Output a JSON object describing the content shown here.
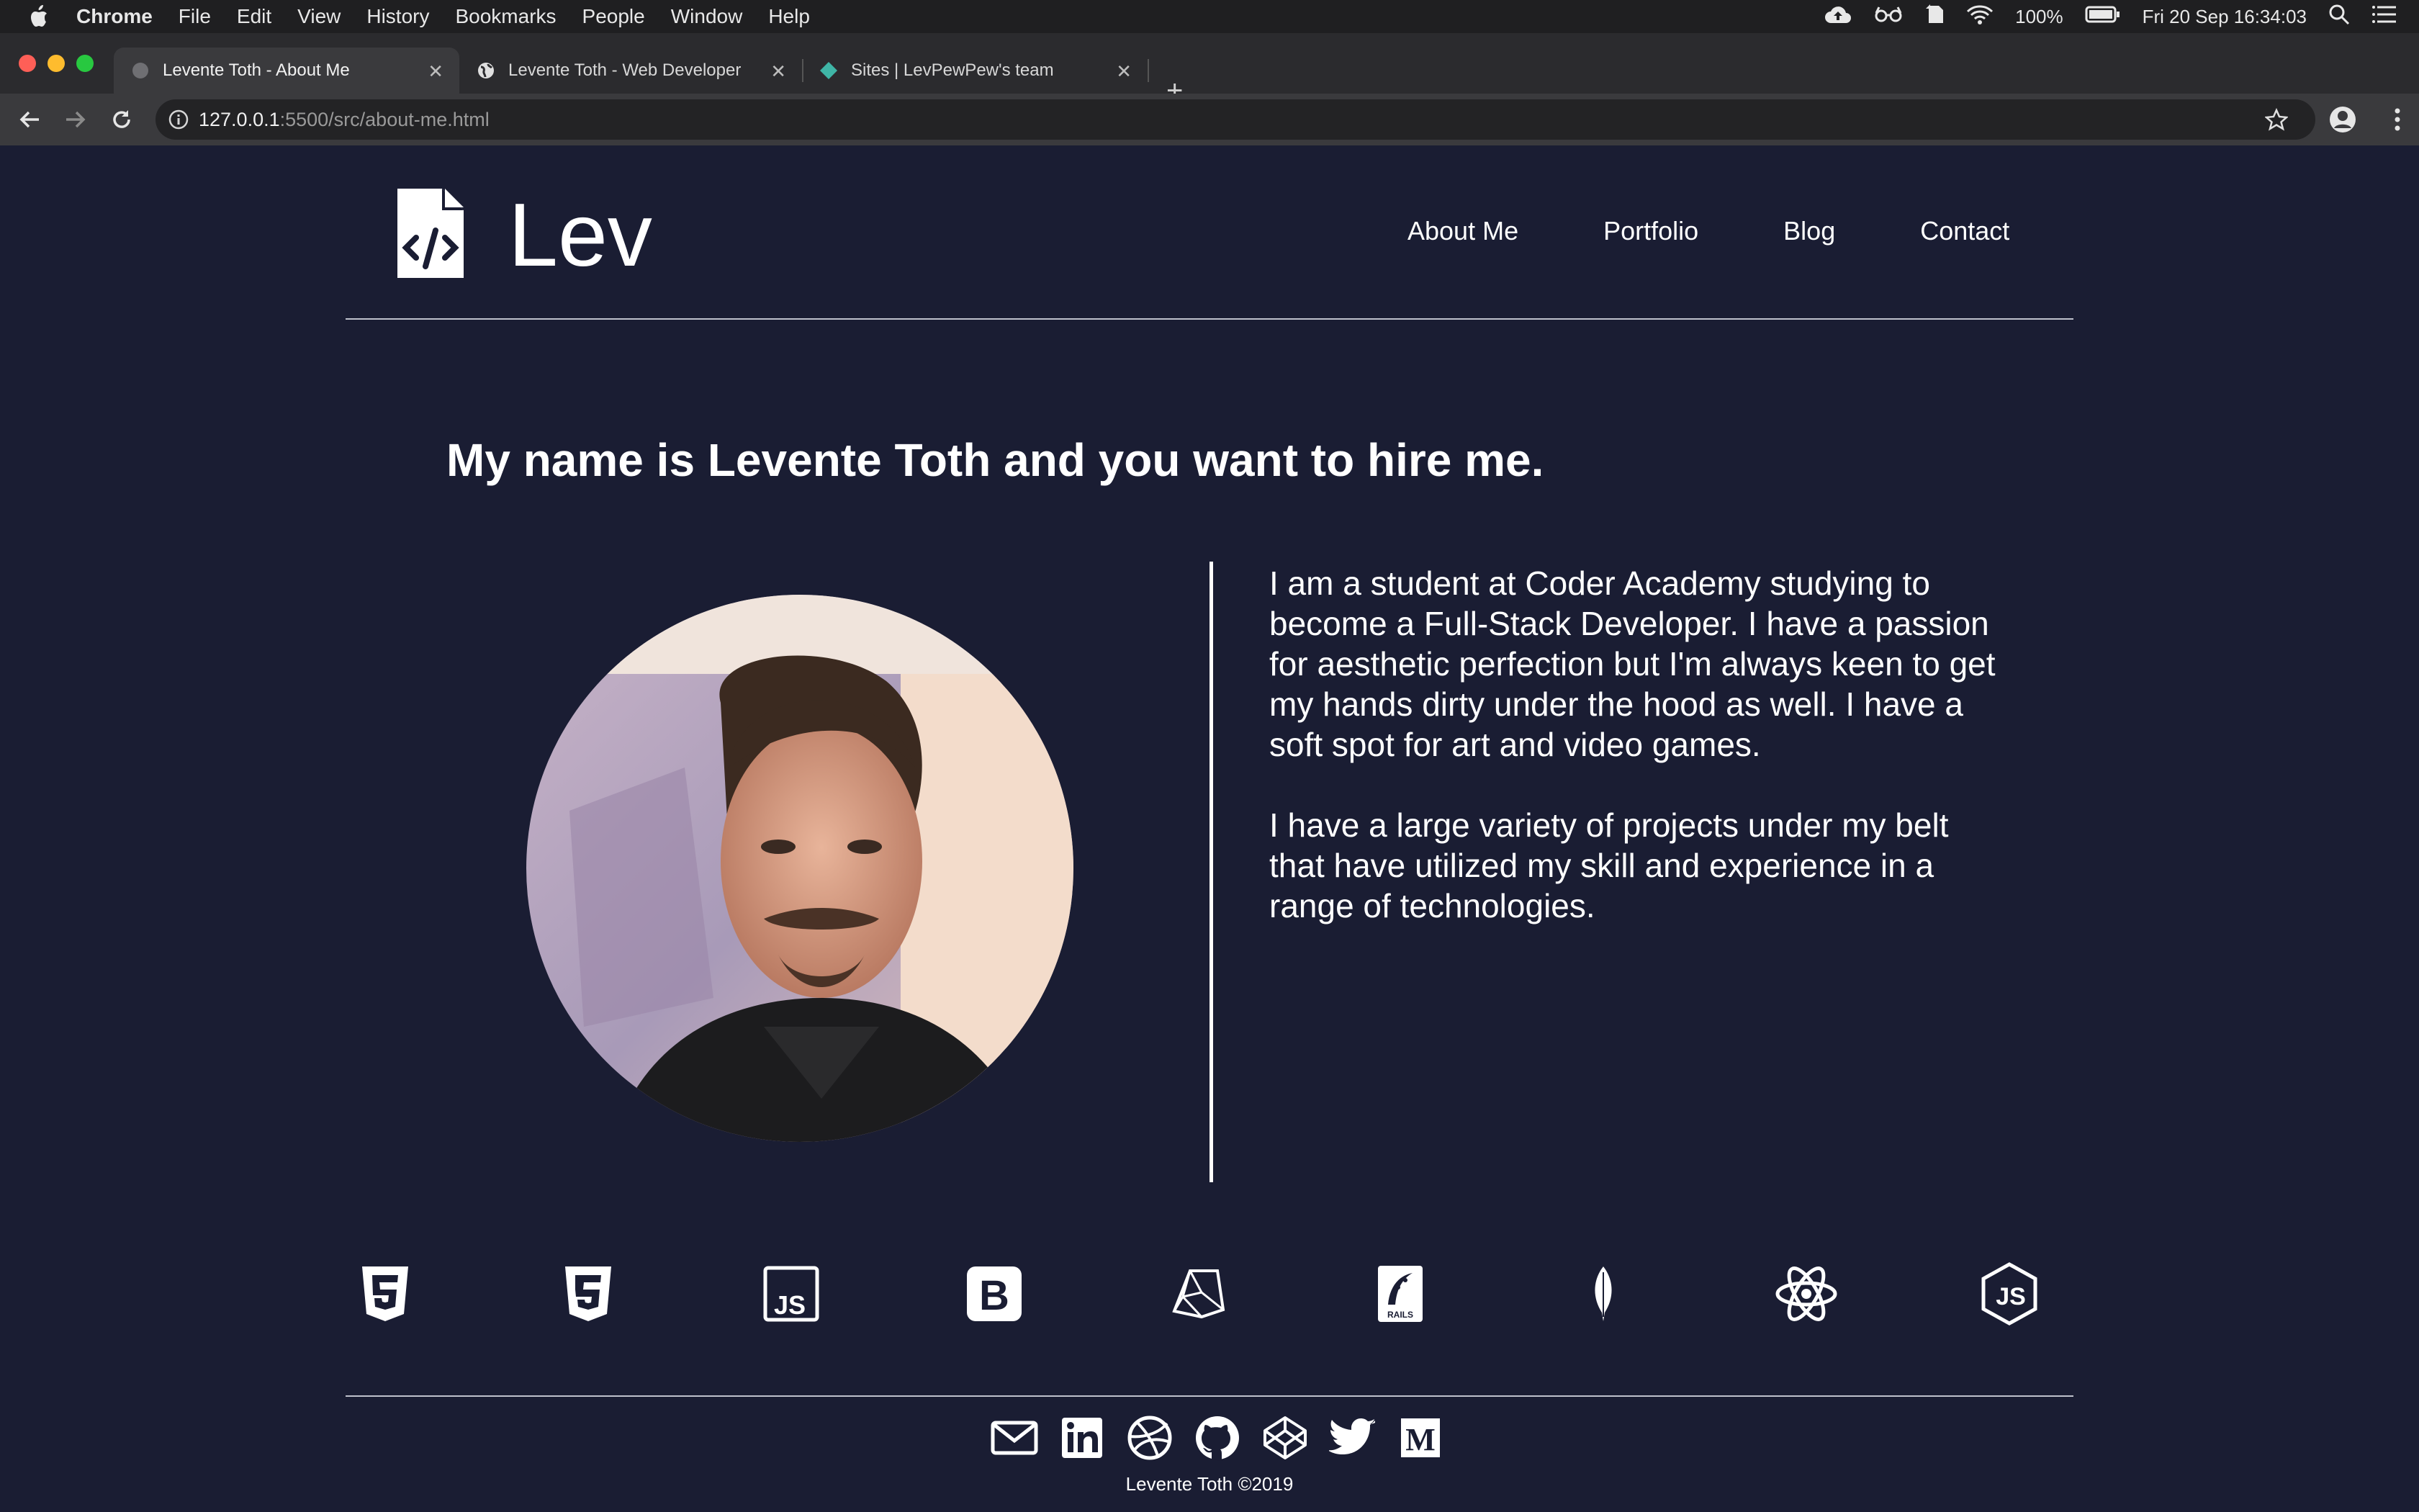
{
  "menubar": {
    "app": "Chrome",
    "items": [
      "File",
      "Edit",
      "View",
      "History",
      "Bookmarks",
      "People",
      "Window",
      "Help"
    ],
    "battery": "100%",
    "clock": "Fri 20 Sep  16:34:03"
  },
  "tabs": [
    {
      "title": "Levente Toth - About Me"
    },
    {
      "title": "Levente Toth - Web Developer"
    },
    {
      "title": "Sites | LevPewPew's team"
    }
  ],
  "omnibox": {
    "host": "127.0.0.1",
    "rest": ":5500/src/about-me.html"
  },
  "site": {
    "brand": "Lev",
    "nav": [
      "About Me",
      "Portfolio",
      "Blog",
      "Contact"
    ],
    "headline": "My name is Levente Toth and you want to hire me.",
    "bio": [
      "I am a student at Coder Academy studying to become a Full-Stack Developer. I have a passion for aesthetic perfection but I'm always keen to get my hands dirty under the hood as well. I have a soft spot for art and video games.",
      "I have a large variety of projects under my belt that have utilized my skill and experience in a range of technologies."
    ],
    "skills_icons": [
      "html5-icon",
      "css3-icon",
      "javascript-icon",
      "bootstrap-icon",
      "ruby-icon",
      "rails-icon",
      "mongodb-icon",
      "react-icon",
      "nodejs-icon"
    ],
    "social_icons": [
      "email-icon",
      "linkedin-icon",
      "dribbble-icon",
      "github-icon",
      "codepen-icon",
      "twitter-icon",
      "medium-icon"
    ],
    "copyright": "Levente Toth ©2019"
  },
  "colors": {
    "page_bg": "#1a1d33",
    "text": "#ffffff"
  }
}
